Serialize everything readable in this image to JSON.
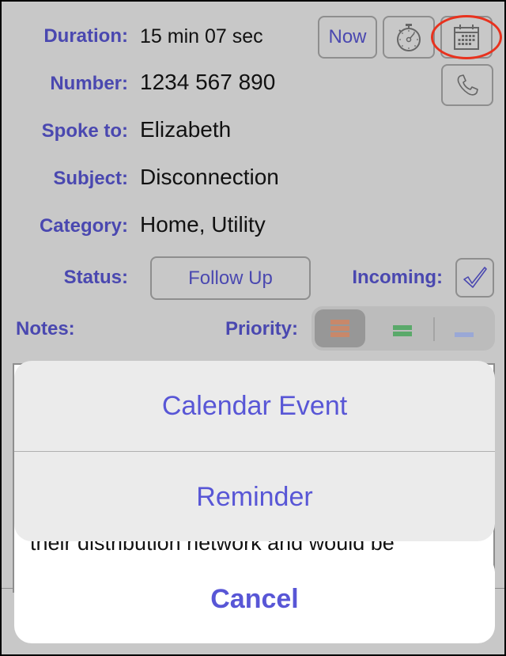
{
  "fields": {
    "duration": {
      "label": "Duration:",
      "value": "15 min 07 sec"
    },
    "number": {
      "label": "Number:",
      "value": "1234 567 890"
    },
    "spoke_to": {
      "label": "Spoke to:",
      "value": "Elizabeth"
    },
    "subject": {
      "label": "Subject:",
      "value": "Disconnection"
    },
    "category": {
      "label": "Category:",
      "value": "Home, Utility"
    }
  },
  "buttons": {
    "now": "Now",
    "stopwatch_icon": "stopwatch-icon",
    "calendar_icon": "calendar-icon",
    "phone_icon": "phone-icon"
  },
  "status": {
    "label": "Status:",
    "value": "Follow Up"
  },
  "incoming": {
    "label": "Incoming:",
    "checked": true
  },
  "notes": {
    "label": "Notes:",
    "visible_text": "their distribution network and would be"
  },
  "priority": {
    "label": "Priority:",
    "options": [
      {
        "name": "high",
        "color": "#c8886a",
        "selected": true
      },
      {
        "name": "medium",
        "color": "#5aa96a",
        "selected": false
      },
      {
        "name": "low",
        "color": "#9aa8d6",
        "selected": false
      }
    ]
  },
  "action_sheet": {
    "items": [
      "Calendar Event",
      "Reminder"
    ],
    "cancel": "Cancel"
  },
  "colors": {
    "label": "#4a48b0",
    "action": "#5856d6",
    "annotation": "#e8321e",
    "background": "#c8c8c8"
  }
}
